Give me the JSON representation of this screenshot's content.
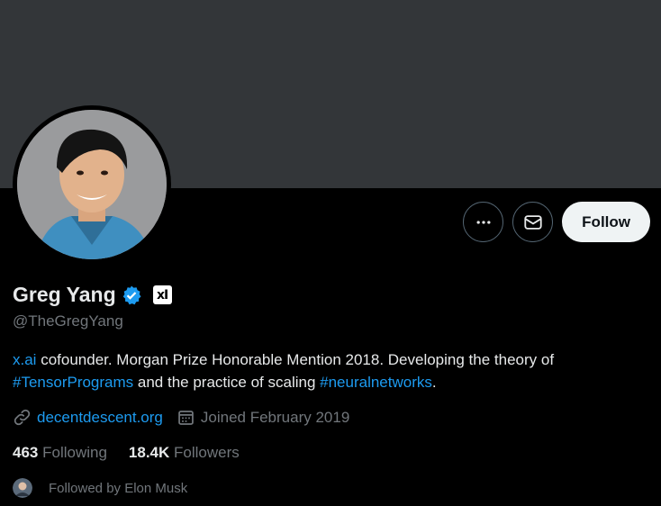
{
  "profile": {
    "display_name": "Greg Yang",
    "handle": "@TheGregYang",
    "verified": true,
    "affiliation_badge": "xI",
    "avatar_icon": "profile-photo"
  },
  "actions": {
    "more_icon": "ellipsis-icon",
    "message_icon": "envelope-icon",
    "follow_label": "Follow"
  },
  "bio": {
    "part1_link": "x.ai",
    "part2": " cofounder. Morgan Prize Honorable Mention 2018. Developing the theory of ",
    "part3_link": "#TensorPrograms",
    "part4": " and the practice of scaling ",
    "part5_link": "#neuralnetworks",
    "part6": "."
  },
  "meta": {
    "website": "decentdescent.org",
    "joined": "Joined February 2019"
  },
  "stats": {
    "following_count": "463",
    "following_label": "Following",
    "followers_count": "18.4K",
    "followers_label": "Followers"
  },
  "followed_by": "Followed by Elon Musk",
  "colors": {
    "banner": "#333639",
    "accent": "#1d9bf0",
    "muted": "#71767b",
    "text": "#e7e9ea",
    "background": "#000000"
  }
}
